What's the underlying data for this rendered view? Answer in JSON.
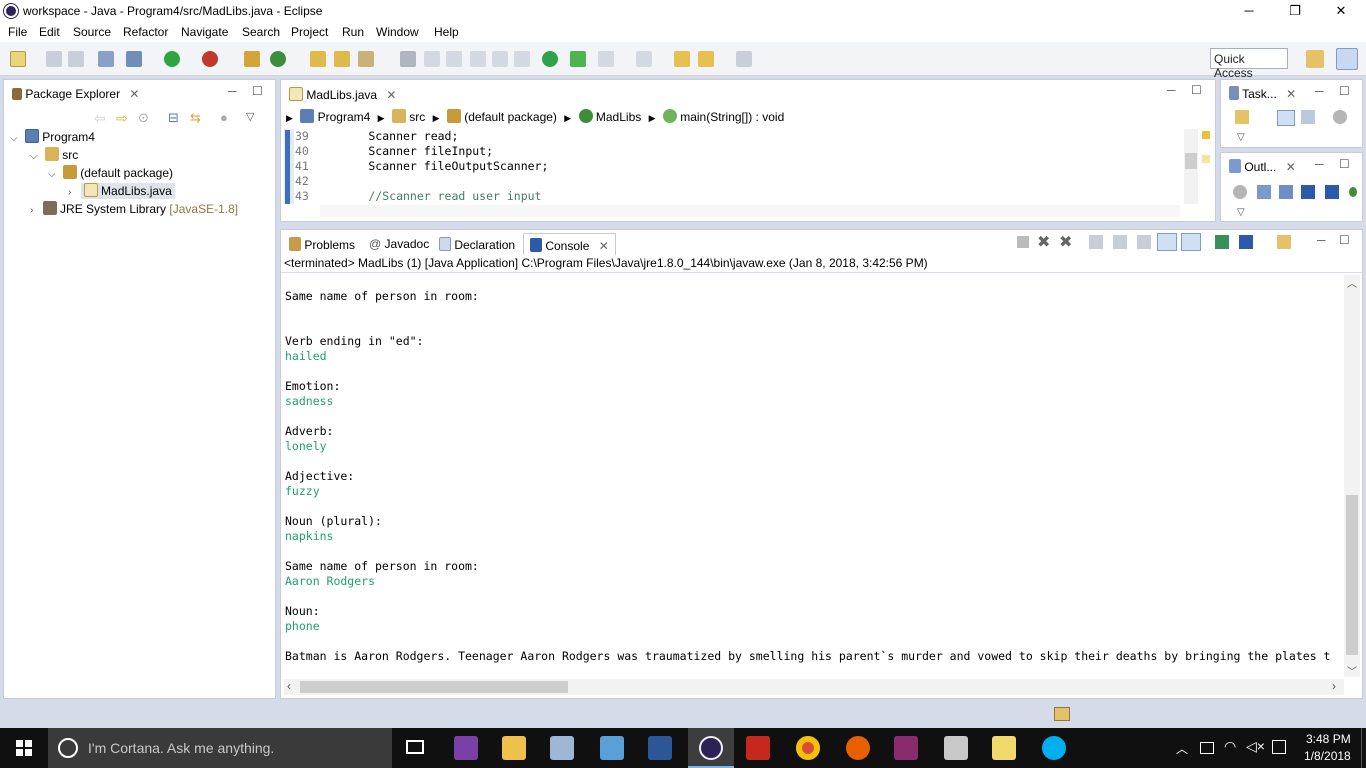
{
  "window": {
    "title": "workspace - Java - Program4/src/MadLibs.java - Eclipse",
    "minimize": "─",
    "maximize": "❐",
    "close": "✕"
  },
  "menu": [
    "File",
    "Edit",
    "Source",
    "Refactor",
    "Navigate",
    "Search",
    "Project",
    "Run",
    "Window",
    "Help"
  ],
  "quick_access": "Quick Access",
  "package_explorer": {
    "title": "Package Explorer",
    "project": "Program4",
    "src": "src",
    "package": "(default package)",
    "file": "MadLibs.java",
    "jre": "JRE System Library",
    "jre_version": "[JavaSE-1.8]"
  },
  "editor": {
    "tab": "MadLibs.java",
    "breadcrumb": [
      "Program4",
      "src",
      "(default package)",
      "MadLibs",
      "main(String[]) : void"
    ],
    "lines": [
      {
        "num": "39",
        "text": "        Scanner read;"
      },
      {
        "num": "40",
        "text": "        Scanner fileInput;"
      },
      {
        "num": "41",
        "text": "        Scanner fileOutputScanner;"
      },
      {
        "num": "42",
        "text": ""
      },
      {
        "num": "43",
        "text": "        //Scanner read user input"
      }
    ]
  },
  "right_panels": {
    "tasks": "Task...",
    "outline": "Outl..."
  },
  "bottom_tabs": [
    "Problems",
    "Javadoc",
    "Declaration",
    "Console"
  ],
  "console": {
    "status": "<terminated> MadLibs (1) [Java Application] C:\\Program Files\\Java\\jre1.8.0_144\\bin\\javaw.exe (Jan 8, 2018, 3:42:56 PM)",
    "lines": [
      {
        "text": "Same name of person in room:",
        "input": false
      },
      {
        "text": "",
        "input": false
      },
      {
        "text": "",
        "input": false
      },
      {
        "text": "Verb ending in \"ed\":",
        "input": false
      },
      {
        "text": "hailed",
        "input": true
      },
      {
        "text": "",
        "input": false
      },
      {
        "text": "Emotion:",
        "input": false
      },
      {
        "text": "sadness",
        "input": true
      },
      {
        "text": "",
        "input": false
      },
      {
        "text": "Adverb:",
        "input": false
      },
      {
        "text": "lonely",
        "input": true
      },
      {
        "text": "",
        "input": false
      },
      {
        "text": "Adjective:",
        "input": false
      },
      {
        "text": "fuzzy",
        "input": true
      },
      {
        "text": "",
        "input": false
      },
      {
        "text": "Noun (plural):",
        "input": false
      },
      {
        "text": "napkins",
        "input": true
      },
      {
        "text": "",
        "input": false
      },
      {
        "text": "Same name of person in room:",
        "input": false
      },
      {
        "text": "Aaron Rodgers",
        "input": true
      },
      {
        "text": "",
        "input": false
      },
      {
        "text": "Noun:",
        "input": false
      },
      {
        "text": "phone",
        "input": true
      },
      {
        "text": "",
        "input": false
      },
      {
        "text": "Batman is Aaron Rodgers. Teenager Aaron Rodgers was traumatized by smelling his parent`s murder and vowed to skip their deaths by bringing the plates t",
        "input": false
      }
    ]
  },
  "taskbar": {
    "search_placeholder": "I'm Cortana. Ask me anything.",
    "time": "3:48 PM",
    "date": "1/8/2018"
  },
  "colors": {
    "console_input": "#1ea36e",
    "comment": "#3f7f5f",
    "accent": "#1f6fc5"
  }
}
